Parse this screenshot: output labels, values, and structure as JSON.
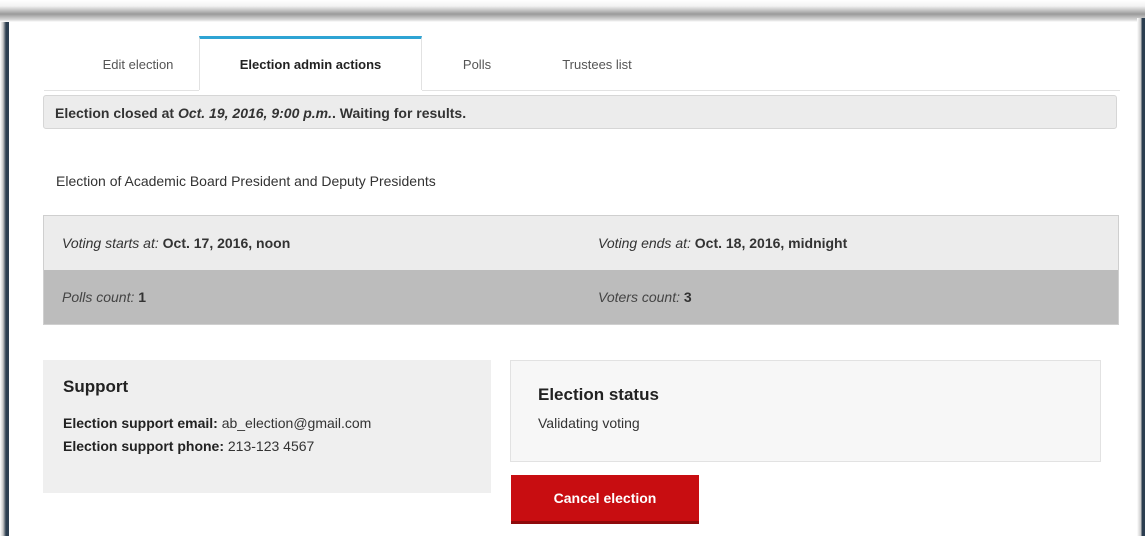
{
  "tabs": [
    {
      "label": "Edit election",
      "active": false
    },
    {
      "label": "Election admin actions",
      "active": true
    },
    {
      "label": "Polls",
      "active": false
    },
    {
      "label": "Trustees list",
      "active": false
    }
  ],
  "alert": {
    "prefix": "Election closed at ",
    "date": "Oct. 19, 2016, 9:00 p.m.",
    "suffix": ". Waiting for results."
  },
  "election_title": "Election of Academic Board President and Deputy Presidents",
  "info": {
    "voting_starts_label": "Voting starts at:",
    "voting_starts_value": "Oct. 17, 2016, noon",
    "voting_ends_label": "Voting ends at:",
    "voting_ends_value": "Oct. 18, 2016, midnight",
    "polls_count_label": "Polls count:",
    "polls_count_value": "1",
    "voters_count_label": "Voters count:",
    "voters_count_value": "3"
  },
  "support": {
    "heading": "Support",
    "email_label": "Election support email:",
    "email_value": "ab_election@gmail.com",
    "phone_label": "Election support phone:",
    "phone_value": "213-123 4567"
  },
  "status": {
    "heading": "Election status",
    "value": "Validating voting"
  },
  "actions": {
    "cancel_label": "Cancel election"
  },
  "colors": {
    "tab_accent": "#2fa4d4",
    "danger": "#c80d11",
    "frame": "#2c3e50"
  }
}
